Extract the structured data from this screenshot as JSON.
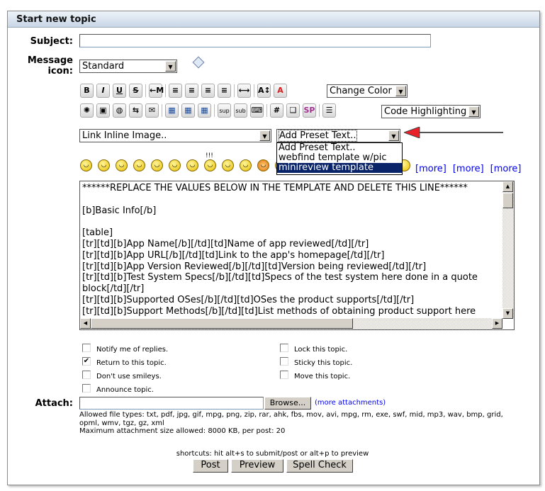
{
  "header": {
    "title": "Start new topic"
  },
  "subject": {
    "label": "Subject:",
    "value": ""
  },
  "message_icon": {
    "label_line1": "Message",
    "label_line2": "icon:",
    "selected": "Standard"
  },
  "toolbar": {
    "row1": [
      {
        "name": "bold",
        "glyph": "B"
      },
      {
        "name": "italic",
        "glyph": "I"
      },
      {
        "name": "underline",
        "glyph": "U"
      },
      {
        "name": "strikethrough",
        "glyph": "S"
      },
      {
        "name": "indent",
        "glyph": "←M"
      },
      {
        "name": "align-justify",
        "glyph": "≡"
      },
      {
        "name": "align-left",
        "glyph": "≡"
      },
      {
        "name": "align-center",
        "glyph": "≡"
      },
      {
        "name": "align-right",
        "glyph": "≡"
      },
      {
        "name": "horizontal-rule",
        "glyph": "⟷"
      },
      {
        "name": "font-size",
        "glyph": "A↕"
      },
      {
        "name": "font-color",
        "glyph": "A"
      }
    ],
    "change_color": "Change Color",
    "row2": [
      {
        "name": "flash",
        "glyph": "✺"
      },
      {
        "name": "image",
        "glyph": "▣"
      },
      {
        "name": "hyperlink",
        "glyph": "◍"
      },
      {
        "name": "ftp",
        "glyph": "⇆"
      },
      {
        "name": "email",
        "glyph": "✉"
      },
      {
        "name": "table",
        "glyph": "▦"
      },
      {
        "name": "table-row",
        "glyph": "▦"
      },
      {
        "name": "table-column",
        "glyph": "▦"
      },
      {
        "name": "superscript",
        "glyph": "sup"
      },
      {
        "name": "subscript",
        "glyph": "sub"
      },
      {
        "name": "teletype",
        "glyph": "⌨"
      },
      {
        "name": "code",
        "glyph": "#"
      },
      {
        "name": "quote",
        "glyph": "❑"
      },
      {
        "name": "spoiler",
        "glyph": "SP"
      },
      {
        "name": "list",
        "glyph": "☰"
      }
    ],
    "code_highlighting": "Code Highlighting",
    "link_inline_image": "Link Inline Image..",
    "preset_text": "Add Preset Text..",
    "preset_options": [
      "Add Preset Text..",
      "webfind template w/pic",
      "minireview template"
    ],
    "preset_highlighted": "minireview template"
  },
  "smileys": {
    "count": 12,
    "more_links": [
      "[more]",
      "[more]",
      "[more]"
    ]
  },
  "message": "******REPLACE THE VALUES BELOW IN THE TEMPLATE AND DELETE THIS LINE******\n\n[b]Basic Info[/b]\n\n[table]\n[tr][td][b]App Name[/b][/td][td]Name of app reviewed[/td][/tr]\n[tr][td][b]App URL[/b][/td][td]Link to the app's homepage[/td][/tr]\n[tr][td][b]App Version Reviewed[/b][/td][td]Version being reviewed[/td][/tr]\n[tr][td][b]Test System Specs[/b][/td][td]Specs of the test system here done in a quote block[/td][/tr]\n[tr][td][b]Supported OSes[/b][/td][td]OSes the product supports[/td][/tr]\n[tr][td][b]Support Methods[/b][/td][td]List methods of obtaining product support here",
  "options": {
    "left": [
      {
        "label": "Notify me of replies.",
        "checked": false
      },
      {
        "label": "Return to this topic.",
        "checked": true
      },
      {
        "label": "Don't use smileys.",
        "checked": false
      },
      {
        "label": "Announce topic.",
        "checked": false
      }
    ],
    "right": [
      {
        "label": "Lock this topic.",
        "checked": false
      },
      {
        "label": "Sticky this topic.",
        "checked": false
      },
      {
        "label": "Move this topic.",
        "checked": false
      }
    ]
  },
  "attach": {
    "label": "Attach:",
    "value": "",
    "browse": "Browse...",
    "more": "(more attachments)",
    "allowed": "Allowed file types: txt, pdf, jpg, gif, mpg, png, zip, rar, ahk, fbs, mov, avi, mpg, rm, exe, swf, mid, mp3, wav, bmp, grid, opml, wmv, tgz, gz, xml",
    "max": "Maximum attachment size allowed: 8000 KB, per post: 20"
  },
  "footer": {
    "shortcuts": "shortcuts: hit alt+s to submit/post or alt+p to preview",
    "post": "Post",
    "preview": "Preview",
    "spell": "Spell Check"
  },
  "colors": {
    "arrow": "#e8202a",
    "highlight": "#0a246a",
    "link": "#0000ee"
  }
}
